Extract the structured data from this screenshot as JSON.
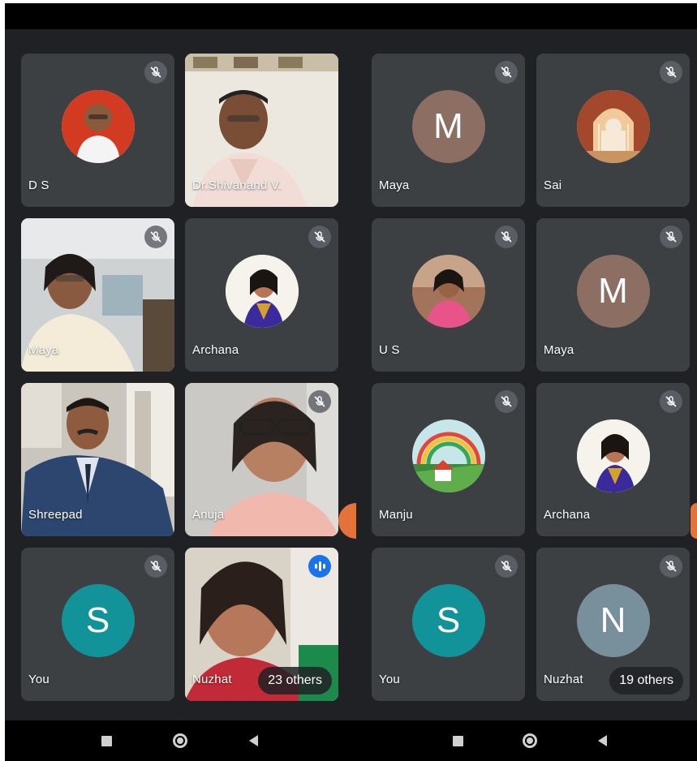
{
  "tiles": [
    {
      "name": "D S",
      "muted": true
    },
    {
      "name": "Dr.Shivanand V."
    },
    {
      "name": "Maya",
      "muted": true
    },
    {
      "name": "Sai",
      "muted": true
    },
    {
      "name": "Maya",
      "muted": true
    },
    {
      "name": "Archana",
      "muted": true
    },
    {
      "name": "U S",
      "muted": true
    },
    {
      "name": "Maya",
      "muted": true,
      "initial": "M",
      "color": "#8d6e63"
    },
    {
      "name": "Shreepad"
    },
    {
      "name": "Anuja",
      "muted": true
    },
    {
      "name": "Manju",
      "muted": true
    },
    {
      "name": "Archana",
      "muted": true
    },
    {
      "name": "You",
      "muted": true,
      "initial": "S",
      "color": "#12939a"
    },
    {
      "name": "Nuzhat",
      "speaking": true,
      "others": "23 others"
    },
    {
      "name": "You",
      "muted": true,
      "initial": "S",
      "color": "#12939a"
    },
    {
      "name": "Nuzhat",
      "muted": true,
      "initial": "N",
      "color": "#78909c",
      "others": "19 others"
    }
  ],
  "left_maya_avatar": {
    "initial": "M",
    "color": "#8d6e63"
  },
  "nav": {
    "icons": [
      "recents-square-icon",
      "home-circle-icon",
      "back-triangle-icon"
    ]
  }
}
